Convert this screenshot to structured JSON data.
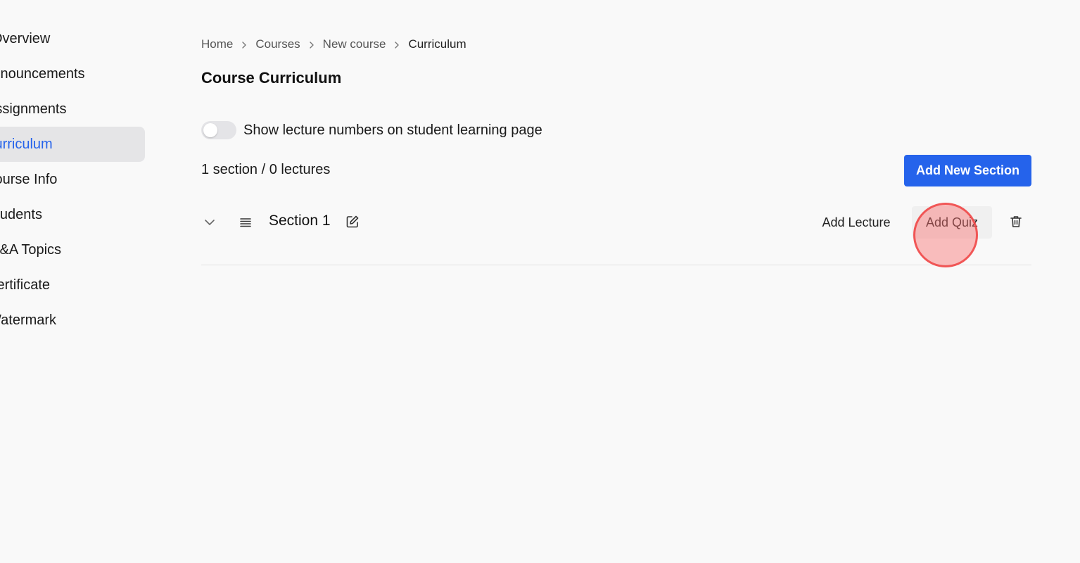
{
  "sidebar": {
    "items": [
      {
        "label": "Overview",
        "icon": "overview"
      },
      {
        "label": "Announcements"
      },
      {
        "label": "Assignments"
      },
      {
        "label": "Curriculum",
        "active": true
      },
      {
        "label": "Course Info"
      },
      {
        "label": "Students"
      },
      {
        "label": "Q&A Topics"
      },
      {
        "label": "Certificate"
      },
      {
        "label": "Watermark"
      }
    ]
  },
  "breadcrumb": {
    "items": [
      "Home",
      "Courses",
      "New course",
      "Curriculum"
    ],
    "separator_icon": "chevron-right-icon"
  },
  "page": {
    "title": "Course Curriculum"
  },
  "toggle": {
    "label": "Show lecture numbers on student learning page",
    "checked": false
  },
  "summary": {
    "count_text": "1 section / 0 lectures"
  },
  "buttons": {
    "add_new_section": "Add New Section"
  },
  "section": {
    "title": "Section 1",
    "add_lecture_label": "Add Lecture",
    "add_quiz_label": "Add Quiz",
    "icons": [
      "chevron-down-icon",
      "drag-handle-icon",
      "edit-icon",
      "trash-icon"
    ]
  },
  "colors": {
    "accent": "#2563eb",
    "active_bg": "#e5e5e7",
    "background": "#f9f9f9",
    "click_indicator": "#ef4444"
  }
}
